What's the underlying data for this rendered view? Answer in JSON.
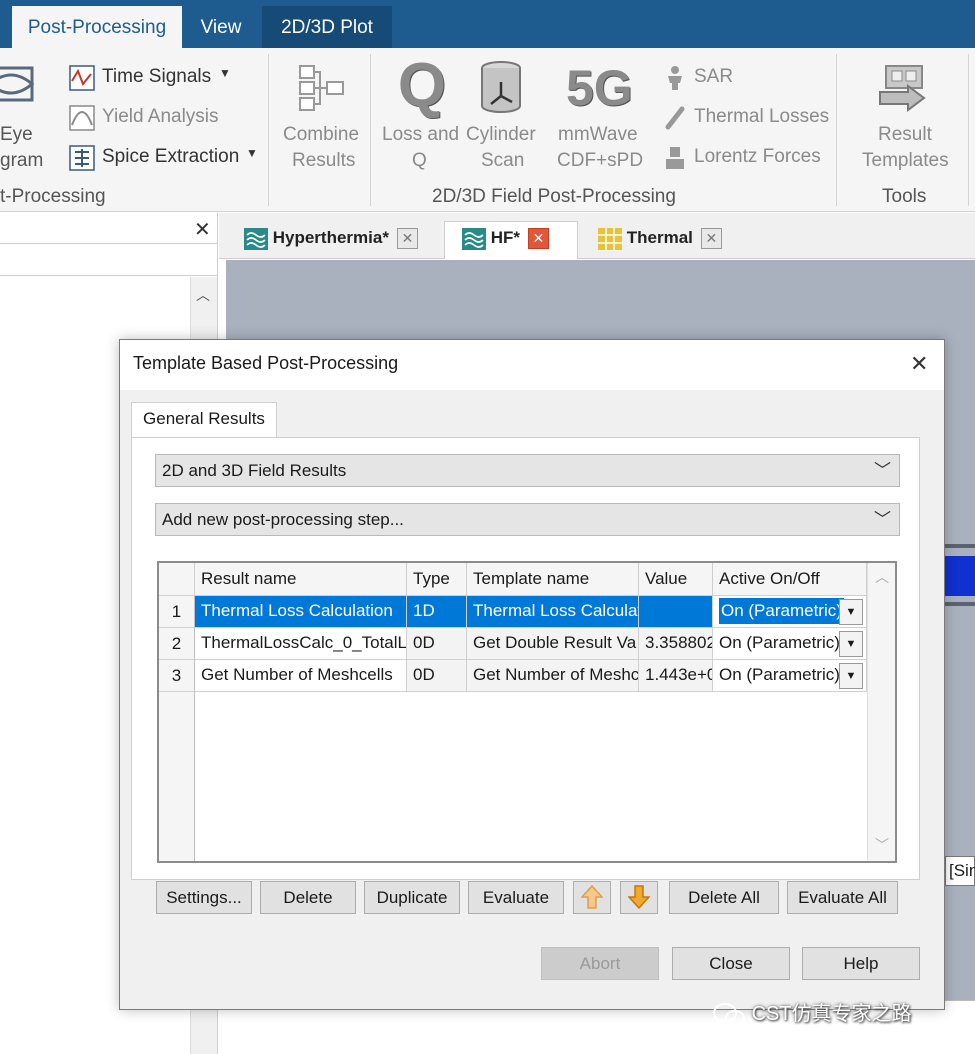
{
  "ribbon": {
    "tabs": [
      {
        "label": "Post-Processing"
      },
      {
        "label": "View"
      },
      {
        "label": "2D/3D Plot"
      }
    ],
    "items": {
      "eye_line1": "Eye",
      "eye_line2": "gram",
      "time_signals": "Time Signals",
      "yield_analysis": "Yield Analysis",
      "spice_extraction": "Spice Extraction",
      "combine_line1": "Combine",
      "combine_line2": "Results",
      "loss_line1": "Loss and",
      "loss_line2": "Q",
      "cyl_line1": "Cylinder",
      "cyl_line2": "Scan",
      "mm_line1": "mmWave",
      "mm_line2": "CDF+sPD",
      "sar": "SAR",
      "thermal_losses": "Thermal Losses",
      "lorentz_forces": "Lorentz Forces",
      "result_line1": "Result",
      "result_line2": "Templates",
      "icon_q": "Q",
      "icon_5g": "5G"
    },
    "groups": {
      "post": "t-Processing",
      "field": "2D/3D Field Post-Processing",
      "tools": "Tools"
    }
  },
  "documents": {
    "tabs": [
      {
        "label": "Hyperthermia*"
      },
      {
        "label": "HF*"
      },
      {
        "label": "Thermal"
      }
    ],
    "status_partial": "[Sin"
  },
  "dialog": {
    "title": "Template Based Post-Processing",
    "tab": "General Results",
    "combo1": "2D and 3D Field Results",
    "combo2": "Add new post-processing step...",
    "table": {
      "headers": [
        "Result name",
        "Type",
        "Template name",
        "Value",
        "Active On/Off"
      ],
      "rows": [
        {
          "num": "1",
          "name": "Thermal Loss Calculation",
          "type": "1D",
          "template": "Thermal Loss Calculat",
          "value": "",
          "active": "On (Parametric)"
        },
        {
          "num": "2",
          "name": "ThermalLossCalc_0_TotalL",
          "type": "0D",
          "template": "Get Double Result Va",
          "value": "3.358802",
          "active": "On (Parametric)"
        },
        {
          "num": "3",
          "name": "Get Number of Meshcells",
          "type": "0D",
          "template": "Get Number of Meshc",
          "value": "1.443e+0",
          "active": "On (Parametric)"
        }
      ]
    },
    "buttons": {
      "settings": "Settings...",
      "delete": "Delete",
      "duplicate": "Duplicate",
      "evaluate": "Evaluate",
      "delete_all": "Delete All",
      "evaluate_all": "Evaluate All",
      "abort": "Abort",
      "close": "Close",
      "help": "Help"
    }
  },
  "watermark": "CST仿真专家之路",
  "colors": {
    "accent": "#1e5c8f",
    "selection": "#0078d7",
    "viewport": "#a9b1be",
    "arrow": "#f0a830"
  }
}
